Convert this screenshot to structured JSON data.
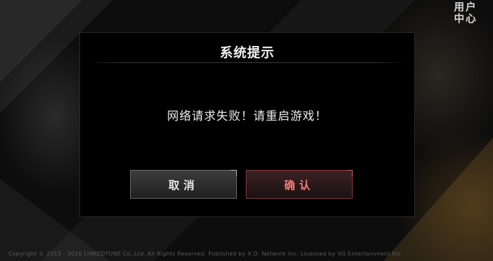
{
  "header": {
    "user_center_line1": "用户",
    "user_center_line2": "中心"
  },
  "dialog": {
    "title": "系统提示",
    "message": "网络请求失败！请重启游戏！",
    "cancel_label": "取消",
    "confirm_label": "确认"
  },
  "footer": {
    "copyright": "Copyright © 2015 - 2016 LINKEDTUNE Co.,Ltd. All Rights Reserved. Published by X.D. Network Inc. Licensed by VG Entertainment Inc."
  },
  "colors": {
    "confirm_text": "#f07e78",
    "confirm_border": "#8a3a3c",
    "cancel_border": "#6a6a6a",
    "dialog_bg": "#000000"
  }
}
